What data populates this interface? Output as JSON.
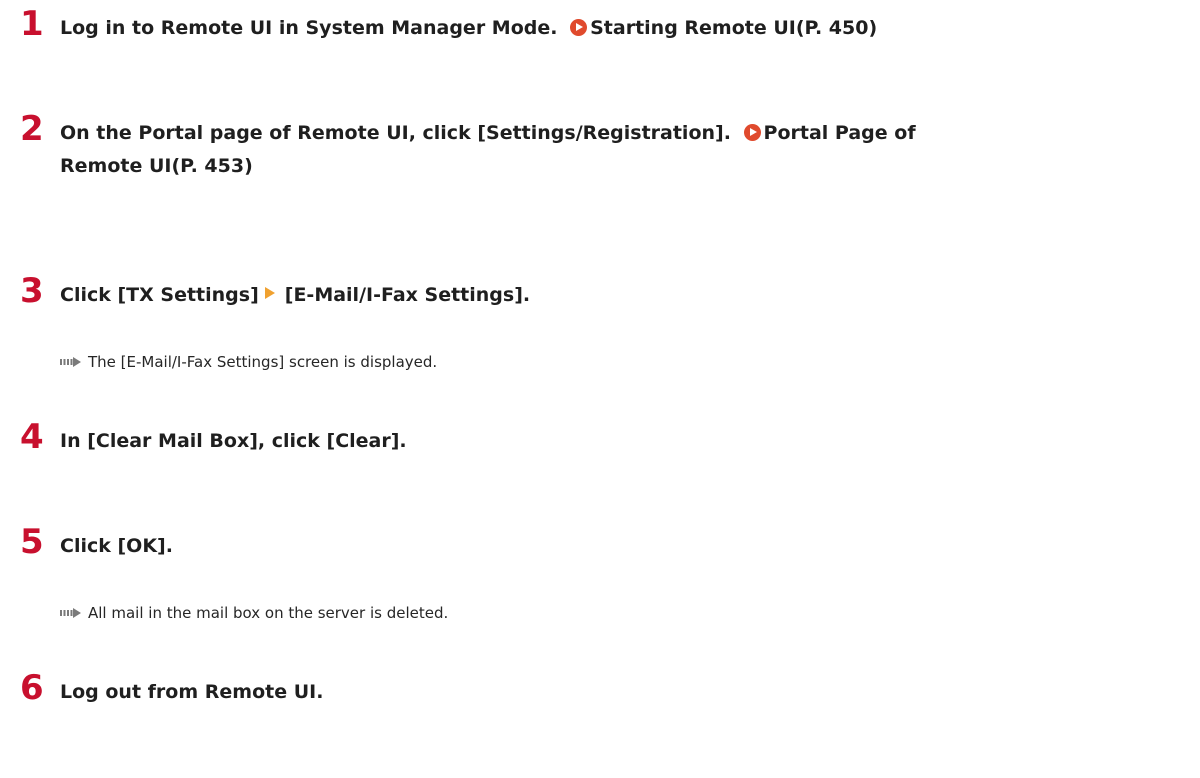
{
  "steps": [
    {
      "number": "1",
      "text": "Log in to Remote UI in System Manager Mode.",
      "link": "Starting Remote UI(P. 450)"
    },
    {
      "number": "2",
      "text": "On the Portal page of Remote UI, click [Settings/Registration].",
      "link_line1": "Portal Page of",
      "link_line2": "Remote UI(P. 453)"
    },
    {
      "number": "3",
      "part1": "Click [TX Settings]",
      "part2": "[E-Mail/I-Fax Settings].",
      "result": "The [E-Mail/I-Fax Settings] screen is displayed."
    },
    {
      "number": "4",
      "text": "In [Clear Mail Box], click [Clear]."
    },
    {
      "number": "5",
      "text": "Click [OK].",
      "result": "All mail in the mail box on the server is deleted."
    },
    {
      "number": "6",
      "text": "Log out from Remote UI."
    }
  ],
  "colors": {
    "step_number": "#c8102e",
    "link_icon": "#e04a2d",
    "menu_arrow": "#f0a130",
    "result_arrow": "#7a7a7a"
  }
}
